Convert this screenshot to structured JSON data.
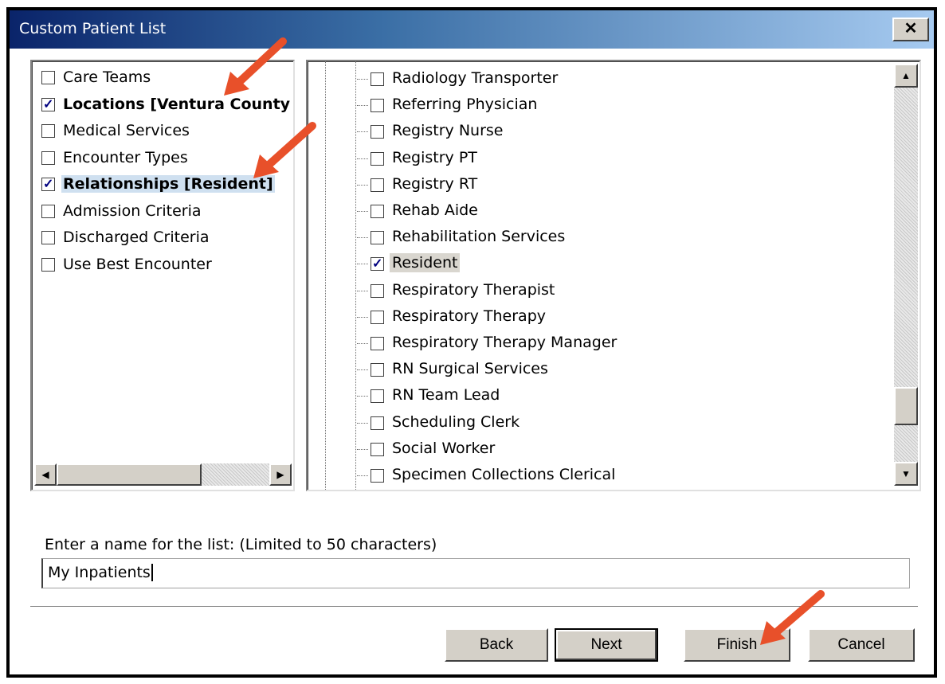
{
  "window": {
    "title": "Custom Patient List",
    "close_label": "✕"
  },
  "left_list": {
    "items": [
      {
        "label": "Care Teams",
        "checked": false,
        "bold": false,
        "selected": false
      },
      {
        "label": "Locations [Ventura County Medical Center]",
        "checked": true,
        "bold": true,
        "selected": false
      },
      {
        "label": "Medical Services",
        "checked": false,
        "bold": false,
        "selected": false
      },
      {
        "label": "Encounter Types",
        "checked": false,
        "bold": false,
        "selected": false
      },
      {
        "label": "Relationships [Resident]",
        "checked": true,
        "bold": true,
        "selected": true
      },
      {
        "label": "Admission Criteria",
        "checked": false,
        "bold": false,
        "selected": false
      },
      {
        "label": "Discharged Criteria",
        "checked": false,
        "bold": false,
        "selected": false
      },
      {
        "label": "Use Best Encounter",
        "checked": false,
        "bold": false,
        "selected": false
      }
    ]
  },
  "right_list": {
    "items": [
      {
        "label": "Radiology Transporter",
        "checked": false
      },
      {
        "label": "Referring Physician",
        "checked": false
      },
      {
        "label": "Registry Nurse",
        "checked": false
      },
      {
        "label": "Registry PT",
        "checked": false
      },
      {
        "label": "Registry RT",
        "checked": false
      },
      {
        "label": "Rehab Aide",
        "checked": false
      },
      {
        "label": "Rehabilitation Services",
        "checked": false
      },
      {
        "label": "Resident",
        "checked": true
      },
      {
        "label": "Respiratory Therapist",
        "checked": false
      },
      {
        "label": "Respiratory Therapy",
        "checked": false
      },
      {
        "label": "Respiratory Therapy Manager",
        "checked": false
      },
      {
        "label": "RN Surgical Services",
        "checked": false
      },
      {
        "label": "RN Team Lead",
        "checked": false
      },
      {
        "label": "Scheduling Clerk",
        "checked": false
      },
      {
        "label": "Social Worker",
        "checked": false
      },
      {
        "label": "Specimen Collections Clerical",
        "checked": false
      }
    ]
  },
  "name_field": {
    "label": "Enter a name for the list: (Limited to 50 characters)",
    "value": "My Inpatients"
  },
  "buttons": {
    "back": "Back",
    "next": "Next",
    "finish": "Finish",
    "cancel": "Cancel"
  },
  "colors": {
    "title_start": "#0a246a",
    "title_end": "#a6caf0",
    "arrow": "#e8502a",
    "face": "#d4d0c8"
  },
  "icons": {
    "scroll_up": "▲",
    "scroll_down": "▼",
    "scroll_left": "◀",
    "scroll_right": "▶"
  }
}
